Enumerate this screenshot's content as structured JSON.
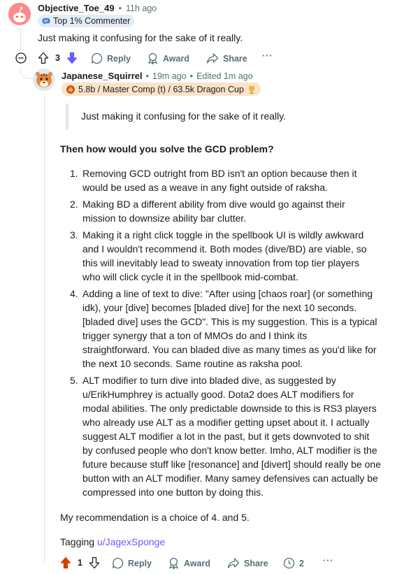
{
  "parent_comment": {
    "username": "Objective_Toe_49",
    "time": "11h ago",
    "separator": "•",
    "badge": "Top 1% Commenter",
    "text": "Just making it confusing for the sake of it really.",
    "actions": {
      "score": "3",
      "reply": "Reply",
      "award": "Award",
      "share": "Share",
      "more": "···"
    }
  },
  "reply_comment": {
    "username": "Japanese_Squirrel",
    "time": "19m ago",
    "edited": "Edited 1m ago",
    "separator": "•",
    "flair": "5.8b / Master Comp (t) / 63.5k Dragon Cup",
    "quote": "Just making it confusing for the sake of it really.",
    "heading": "Then how would you solve the GCD problem?",
    "list": [
      {
        "num": "1.",
        "lines": [
          "Removing GCD outright from BD isn't an option because then it",
          "would be used as a weave in any fight outside of raksha."
        ]
      },
      {
        "num": "2.",
        "lines": [
          "Making BD a different ability from dive would go against their",
          "mission to downsize ability bar clutter."
        ]
      },
      {
        "num": "3.",
        "lines": [
          "Making it a right click toggle in the spellbook UI is wildly awkward",
          "and I wouldn't recommend it. Both modes (dive/BD) are viable, so",
          "this will inevitably lead to sweaty innovation from top tier players",
          "who will click cycle it in the spellbook mid-combat."
        ]
      },
      {
        "num": "4.",
        "lines": [
          "Adding a line of text to dive: \"After using [chaos roar] (or something",
          "idk), your [dive] becomes [bladed dive] for the next 10 seconds.",
          "[bladed dive] uses the GCD\". This is my suggestion. This is a typical",
          "trigger synergy that a ton of MMOs do and I think its",
          "straightforward. You can bladed dive as many times as you'd like for",
          "the next 10 seconds. Same routine as raksha pool."
        ]
      },
      {
        "num": "5.",
        "lines": [
          "ALT modifier to turn dive into bladed dive, as suggested by",
          "u/ErikHumphrey is actually good. Dota2 does ALT modifiers for",
          "modal abilities. The only predictable downside to this is RS3 players",
          "who already use ALT as a modifier getting upset about it. I actually",
          "suggest ALT modifier a lot in the past, but it gets downvoted to shit",
          "by confused people who don't know better. Imho, ALT modifier is the",
          "future because stuff like [resonance] and [divert] should really be one",
          "button with an ALT modifier. Many samey defensives can actually be",
          "compressed into one button by doing this."
        ]
      }
    ],
    "recommendation": "My recommendation is a choice of 4. and 5.",
    "tagging_label": "Tagging",
    "tagging_user": "u/JagexSponge",
    "actions": {
      "score": "1",
      "reply": "Reply",
      "award": "Award",
      "share": "Share",
      "thread_count": "2",
      "more": "···"
    }
  },
  "colors": {
    "upvote_active": "#d93a00",
    "downvote_active": "#6a5cff",
    "link": "#6a5cff",
    "muted": "#576f76"
  }
}
